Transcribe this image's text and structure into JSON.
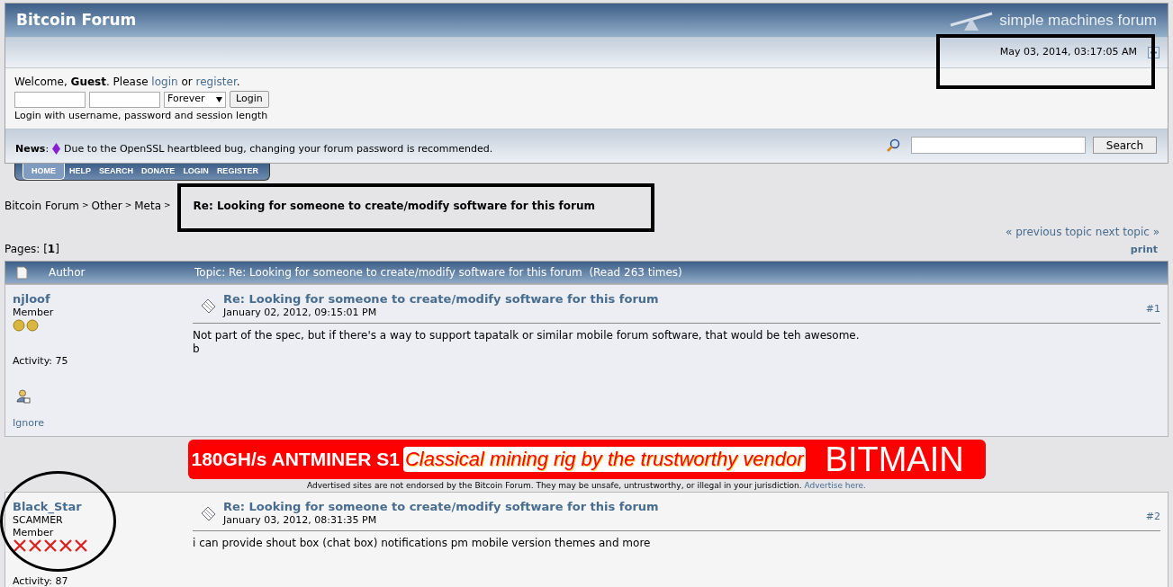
{
  "header": {
    "title": "Bitcoin Forum",
    "logo_text": "simple machines forum",
    "date": "May 03, 2014, 03:17:05 AM"
  },
  "user_section": {
    "welcome": "Welcome, **Guest**. Please",
    "login_link": "login",
    "or": "or",
    "register_link": "register",
    "period": ".",
    "session_option": "Forever",
    "login_button": "Login",
    "hint": "Login with username, password and session length"
  },
  "news": {
    "label": "**News**:",
    "text": "Due to the OpenSSL heartbleed bug, changing your forum password is recommended.",
    "search_button": "Search"
  },
  "menu": [
    {
      "label": "HOME",
      "selected": true
    },
    {
      "label": "HELP",
      "selected": false
    },
    {
      "label": "SEARCH",
      "selected": false
    },
    {
      "label": "DONATE",
      "selected": false
    },
    {
      "label": "LOGIN",
      "selected": false
    },
    {
      "label": "REGISTER",
      "selected": false
    }
  ],
  "breadcrumb": [
    {
      "label": "Bitcoin Forum"
    },
    {
      "label": "Other"
    },
    {
      "label": "Meta"
    },
    {
      "label": "Re: Looking for someone to create/modify software for this forum"
    }
  ],
  "breadcrumb_separator": ">",
  "topic_nav": {
    "previous": "« previous topic",
    "next": "next topic »",
    "print": "print",
    "pages_label": "Pages: [",
    "current_page": "1",
    "pages_end": "]"
  },
  "topic_header": {
    "author": "Author",
    "topic": "Topic: Re: Looking for someone to create/modify software for this forum  (Read 263 times)"
  },
  "posts": [
    {
      "author": "njloof",
      "ranks": [
        "Member"
      ],
      "rank_icons": [
        {
          "kind": "coin"
        },
        {
          "kind": "coin"
        }
      ],
      "activity": "Activity: 75",
      "ignore": "Ignore",
      "title": "Re: Looking for someone to create/modify software for this forum",
      "date": "January 02, 2012, 09:15:01 PM",
      "number": "#1",
      "body": [
        "Not part of the spec, but if there's a way to support tapatalk or similar mobile forum software, that would be teh awesome.",
        "b"
      ]
    },
    {
      "author": "Black_Star",
      "ranks": [
        "SCAMMER",
        "Member"
      ],
      "rank_icons": [
        {
          "kind": "cross"
        },
        {
          "kind": "cross"
        },
        {
          "kind": "cross"
        },
        {
          "kind": "cross"
        },
        {
          "kind": "cross"
        }
      ],
      "activity": "Activity: 87",
      "title": "Re: Looking for someone to create/modify software for this forum",
      "date": "January 03, 2012, 08:31:35 PM",
      "number": "#2",
      "body": [
        "i can provide shout box (chat box) notifications pm mobile version themes and more"
      ]
    }
  ],
  "ad": {
    "product": "180GH/s ANTMINER S1",
    "slogan": "Classical mining rig by the trustworthy vendor",
    "brand": "BITMAIN",
    "disclaimer": "Advertised sites are not endorsed by the Bitcoin Forum. They may be unsafe, untrustworthy, or illegal in your jurisdiction.",
    "advertise_link": "Advertise here."
  },
  "annotations": [
    {
      "kind": "rectangle"
    },
    {
      "kind": "rectangle"
    },
    {
      "kind": "ellipse"
    }
  ]
}
